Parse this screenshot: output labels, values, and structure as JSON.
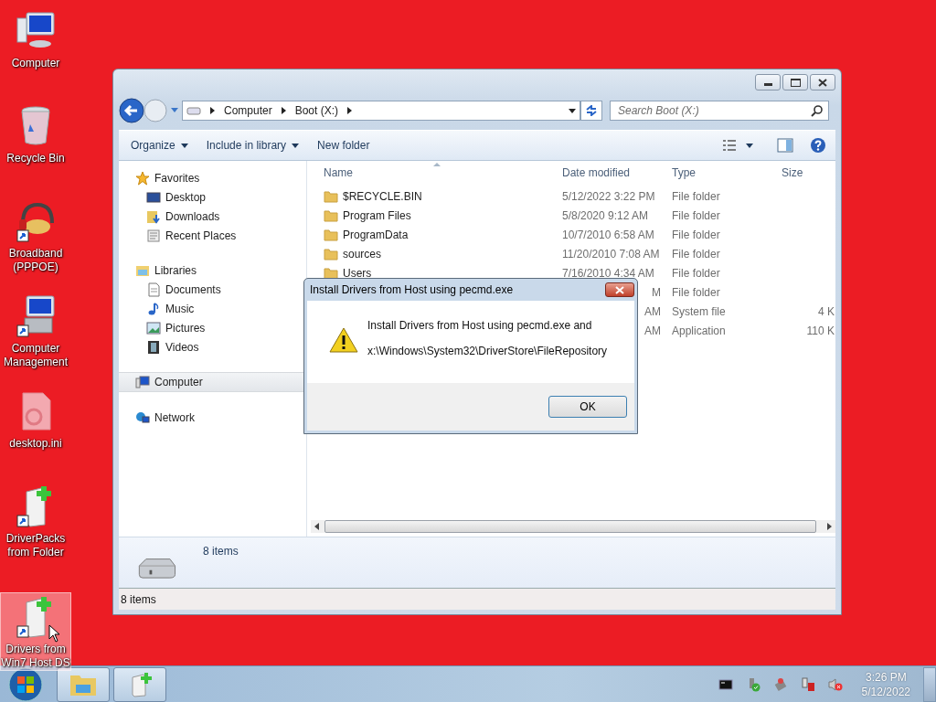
{
  "desktop": {
    "icons": [
      {
        "label": "Computer",
        "kind": "computer",
        "selected": false
      },
      {
        "label": "Recycle Bin",
        "kind": "recycle",
        "selected": false
      },
      {
        "label": "Broadband (PPPOE)",
        "kind": "broadband",
        "selected": false
      },
      {
        "label": "Computer Management",
        "kind": "management",
        "selected": false
      },
      {
        "label": "desktop.ini",
        "kind": "ini",
        "selected": false
      },
      {
        "label": "DriverPacks from Folder",
        "kind": "driver",
        "selected": false
      },
      {
        "label": "Drivers from Win7 Host DS",
        "kind": "driver",
        "selected": true
      }
    ]
  },
  "explorer": {
    "address": [
      "Computer",
      "Boot (X:)"
    ],
    "search": {
      "placeholder": "Search Boot (X:)"
    },
    "toolbar": [
      {
        "label": "Organize",
        "dropdown": true
      },
      {
        "label": "Include in library",
        "dropdown": true
      },
      {
        "label": "New folder",
        "dropdown": false
      }
    ],
    "nav": [
      {
        "label": "Favorites",
        "kind": "star",
        "selected": false,
        "children": [
          {
            "label": "Desktop",
            "kind": "desktop",
            "selected": false
          },
          {
            "label": "Downloads",
            "kind": "downloads",
            "selected": false
          },
          {
            "label": "Recent Places",
            "kind": "recent",
            "selected": false
          }
        ]
      },
      {
        "label": "Libraries",
        "kind": "libraries",
        "selected": false,
        "children": [
          {
            "label": "Documents",
            "kind": "documents",
            "selected": false
          },
          {
            "label": "Music",
            "kind": "music",
            "selected": false
          },
          {
            "label": "Pictures",
            "kind": "pictures",
            "selected": false
          },
          {
            "label": "Videos",
            "kind": "videos",
            "selected": false
          }
        ]
      },
      {
        "label": "Computer",
        "kind": "computer",
        "selected": true
      },
      {
        "label": "Network",
        "kind": "network",
        "selected": false
      }
    ],
    "columns": [
      "Name",
      "Date modified",
      "Type",
      "Size"
    ],
    "rows": [
      {
        "name": "$RECYCLE.BIN",
        "date": "5/12/2022 3:22 PM",
        "type": "File folder"
      },
      {
        "name": "Program Files",
        "date": "5/8/2020 9:12 AM",
        "type": "File folder"
      },
      {
        "name": "ProgramData",
        "date": "10/7/2010 6:58 AM",
        "type": "File folder"
      },
      {
        "name": "sources",
        "date": "11/20/2010 7:08 AM",
        "type": "File folder"
      },
      {
        "name": "Users",
        "date": "7/16/2010 4:34 AM",
        "type": "File folder"
      },
      {
        "date": "M",
        "type": "File folder"
      },
      {
        "date": "AM",
        "type": "System file",
        "size": "4 K"
      },
      {
        "date": "AM",
        "type": "Application",
        "size": "110 K"
      }
    ],
    "details": {
      "count": "8 items"
    },
    "status": "8 items"
  },
  "dialog": {
    "title": "Install Drivers from Host using pecmd.exe",
    "lines": [
      "Install Drivers from Host using pecmd.exe and",
      "x:\\Windows\\System32\\DriverStore\\FileRepository"
    ],
    "button": "OK"
  },
  "taskbar": {
    "buttons": [
      {
        "kind": "explorer"
      },
      {
        "kind": "driver"
      }
    ],
    "time": "3:26 PM",
    "date": "5/12/2022"
  }
}
